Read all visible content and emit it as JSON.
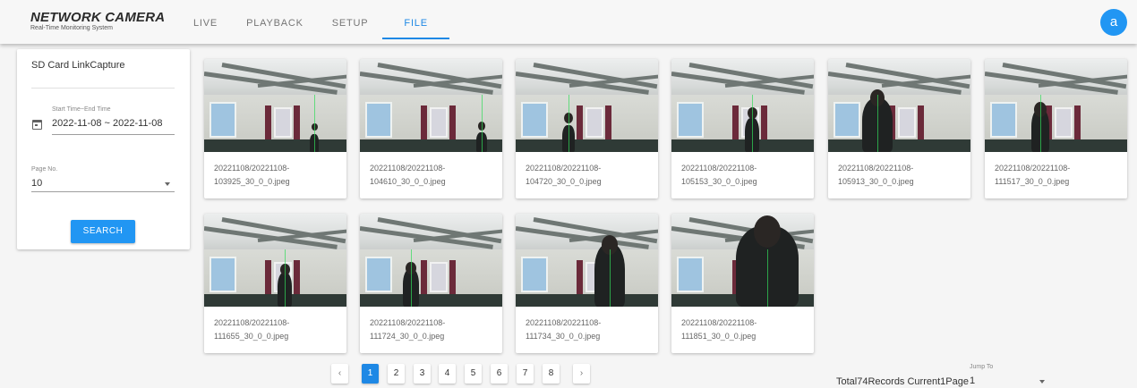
{
  "header": {
    "brand_title": "NETWORK CAMERA",
    "brand_subtitle": "Real-Time Monitoring System",
    "tabs": [
      {
        "label": "LIVE"
      },
      {
        "label": "PLAYBACK"
      },
      {
        "label": "SETUP"
      },
      {
        "label": "FILE",
        "active": true
      }
    ],
    "avatar_letter": "a"
  },
  "sidebar": {
    "title": "SD Card LinkCapture",
    "time_label": "Start Time~End Time",
    "time_value": "2022-11-08 ~ 2022-11-08",
    "page_no_label": "Page No.",
    "page_no_value": "10",
    "search_label": "SEARCH"
  },
  "gallery": {
    "items": [
      {
        "line1": "20221108/20221108-",
        "line2": "103925_30_0_0.jpeg"
      },
      {
        "line1": "20221108/20221108-",
        "line2": "104610_30_0_0.jpeg"
      },
      {
        "line1": "20221108/20221108-",
        "line2": "104720_30_0_0.jpeg"
      },
      {
        "line1": "20221108/20221108-",
        "line2": "105153_30_0_0.jpeg"
      },
      {
        "line1": "20221108/20221108-",
        "line2": "105913_30_0_0.jpeg"
      },
      {
        "line1": "20221108/20221108-",
        "line2": "111517_30_0_0.jpeg"
      },
      {
        "line1": "20221108/20221108-",
        "line2": "111655_30_0_0.jpeg"
      },
      {
        "line1": "20221108/20221108-",
        "line2": "111724_30_0_0.jpeg"
      },
      {
        "line1": "20221108/20221108-",
        "line2": "111734_30_0_0.jpeg"
      },
      {
        "line1": "20221108/20221108-",
        "line2": "111851_30_0_0.jpeg"
      }
    ]
  },
  "pagination": {
    "prev_icon": "chevron-left-icon",
    "next_icon": "chevron-right-icon",
    "pages": [
      "1",
      "2",
      "3",
      "4",
      "5",
      "6",
      "7",
      "8"
    ],
    "current": "1",
    "summary": "Total74Records Current1Page",
    "jump_label": "Jump To",
    "jump_value": "1"
  },
  "colors": {
    "accent": "#1e88e5",
    "button": "#2196f3"
  }
}
